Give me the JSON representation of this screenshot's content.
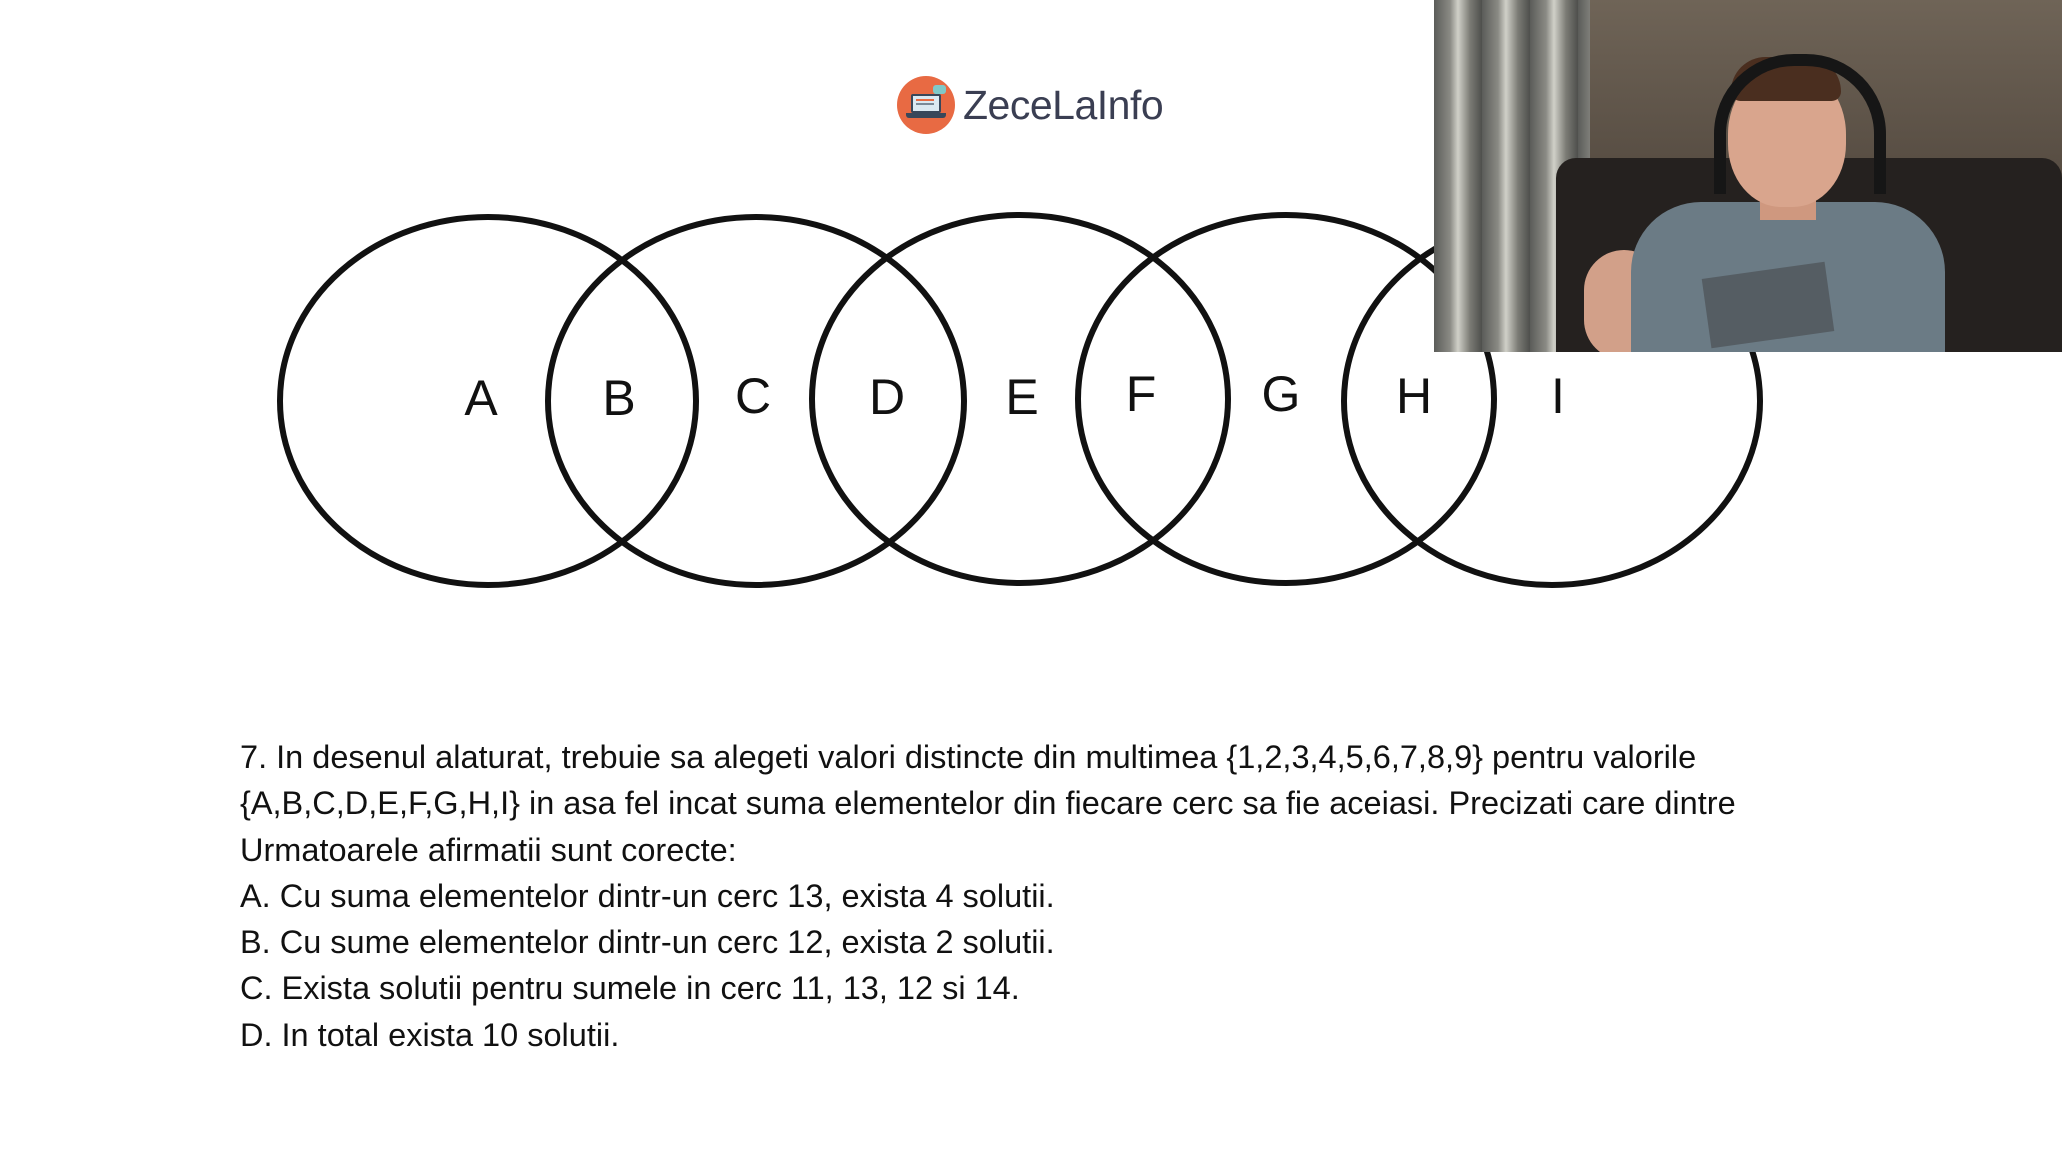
{
  "logo": {
    "text": "ZeceLaInfo",
    "icon": "laptop-logo-icon",
    "colors": {
      "mark": "#e86a43",
      "text": "#3a3e52"
    }
  },
  "diagram": {
    "labels": [
      "A",
      "B",
      "C",
      "D",
      "E",
      "F",
      "G",
      "H",
      "I"
    ]
  },
  "question": {
    "lines": [
      "7. In desenul alaturat, trebuie sa alegeti valori distincte din multimea {1,2,3,4,5,6,7,8,9} pentru valorile",
      "{A,B,C,D,E,F,G,H,I} in asa fel incat suma elementelor din fiecare cerc sa fie aceiasi. Precizati care dintre",
      "Urmatoarele afirmatii sunt corecte:",
      "A. Cu suma elementelor dintr-un cerc 13, exista 4 solutii.",
      "B. Cu sume elementelor dintr-un cerc 12, exista 2 solutii.",
      "C. Exista solutii pentru sumele in cerc 11, 13, 12 si 14.",
      "D. In total exista 10 solutii."
    ]
  },
  "webcam": {
    "subject": "presenter-webcam"
  }
}
